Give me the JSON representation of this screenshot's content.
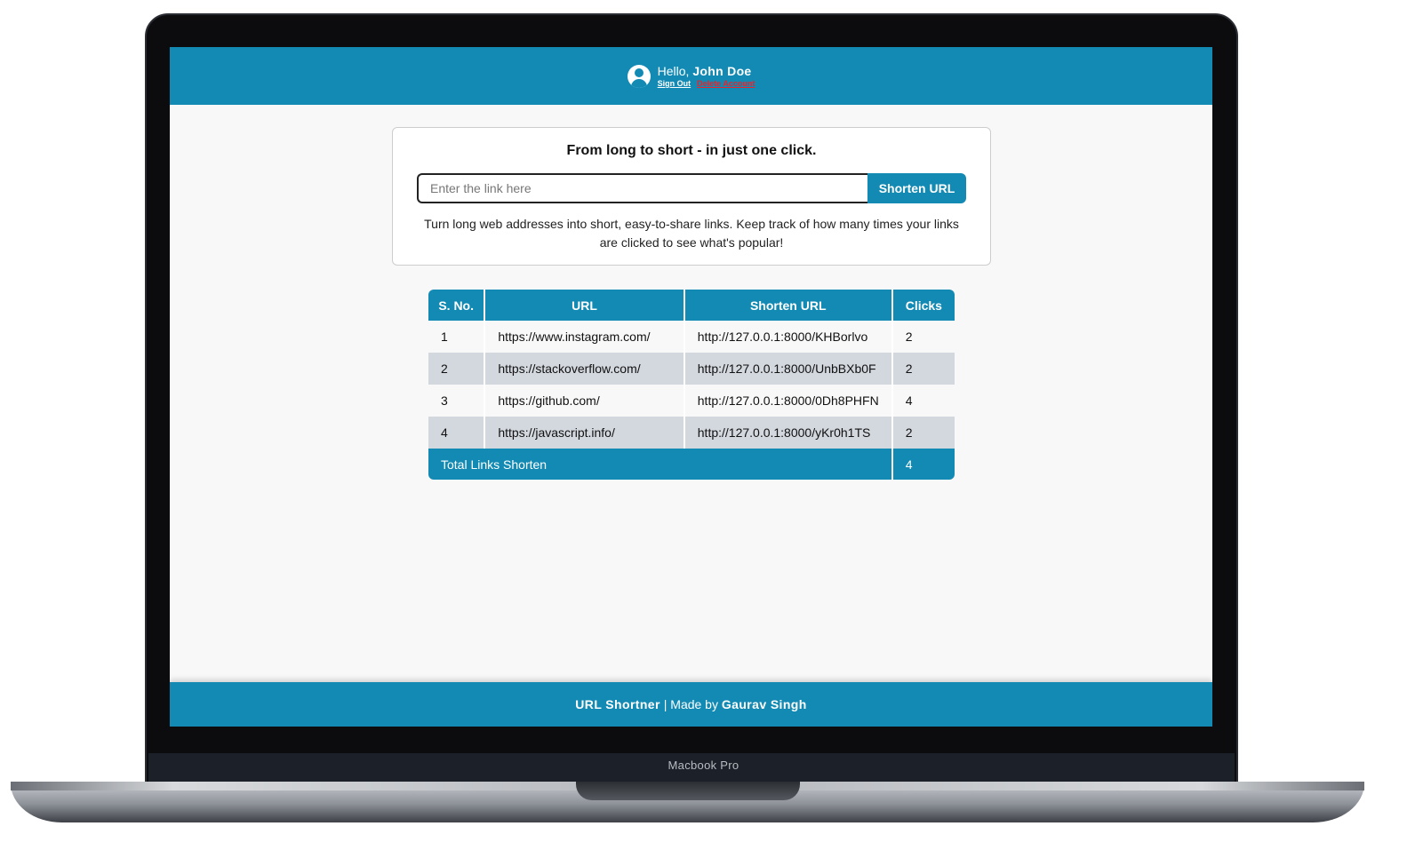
{
  "device": {
    "label": "Macbook Pro"
  },
  "header": {
    "greeting_prefix": "Hello,",
    "user_name": "John Doe",
    "sign_out": "Sign Out",
    "delete_account": "Delete Account"
  },
  "shortener": {
    "title": "From long to short - in just one click.",
    "placeholder": "Enter the link here",
    "value": "",
    "button": "Shorten URL",
    "description": "Turn long web addresses into short, easy-to-share links. Keep track of how many times your links are clicked to see what's popular!"
  },
  "table": {
    "headers": [
      "S. No.",
      "URL",
      "Shorten URL",
      "Clicks"
    ],
    "rows": [
      {
        "sno": "1",
        "url": "https://www.instagram.com/",
        "short": "http://127.0.0.1:8000/KHBorlvo",
        "clicks": "2"
      },
      {
        "sno": "2",
        "url": "https://stackoverflow.com/",
        "short": "http://127.0.0.1:8000/UnbBXb0F",
        "clicks": "2"
      },
      {
        "sno": "3",
        "url": "https://github.com/",
        "short": "http://127.0.0.1:8000/0Dh8PHFN",
        "clicks": "4"
      },
      {
        "sno": "4",
        "url": "https://javascript.info/",
        "short": "http://127.0.0.1:8000/yKr0h1TS",
        "clicks": "2"
      }
    ],
    "total_label": "Total Links Shorten",
    "total_value": "4"
  },
  "footer": {
    "app_name": "URL Shortner",
    "made_by": " | Made by ",
    "author": "Gaurav Singh"
  },
  "colors": {
    "primary": "#128ab3",
    "row_alt": "#d3d7de",
    "danger": "#e8242c"
  }
}
